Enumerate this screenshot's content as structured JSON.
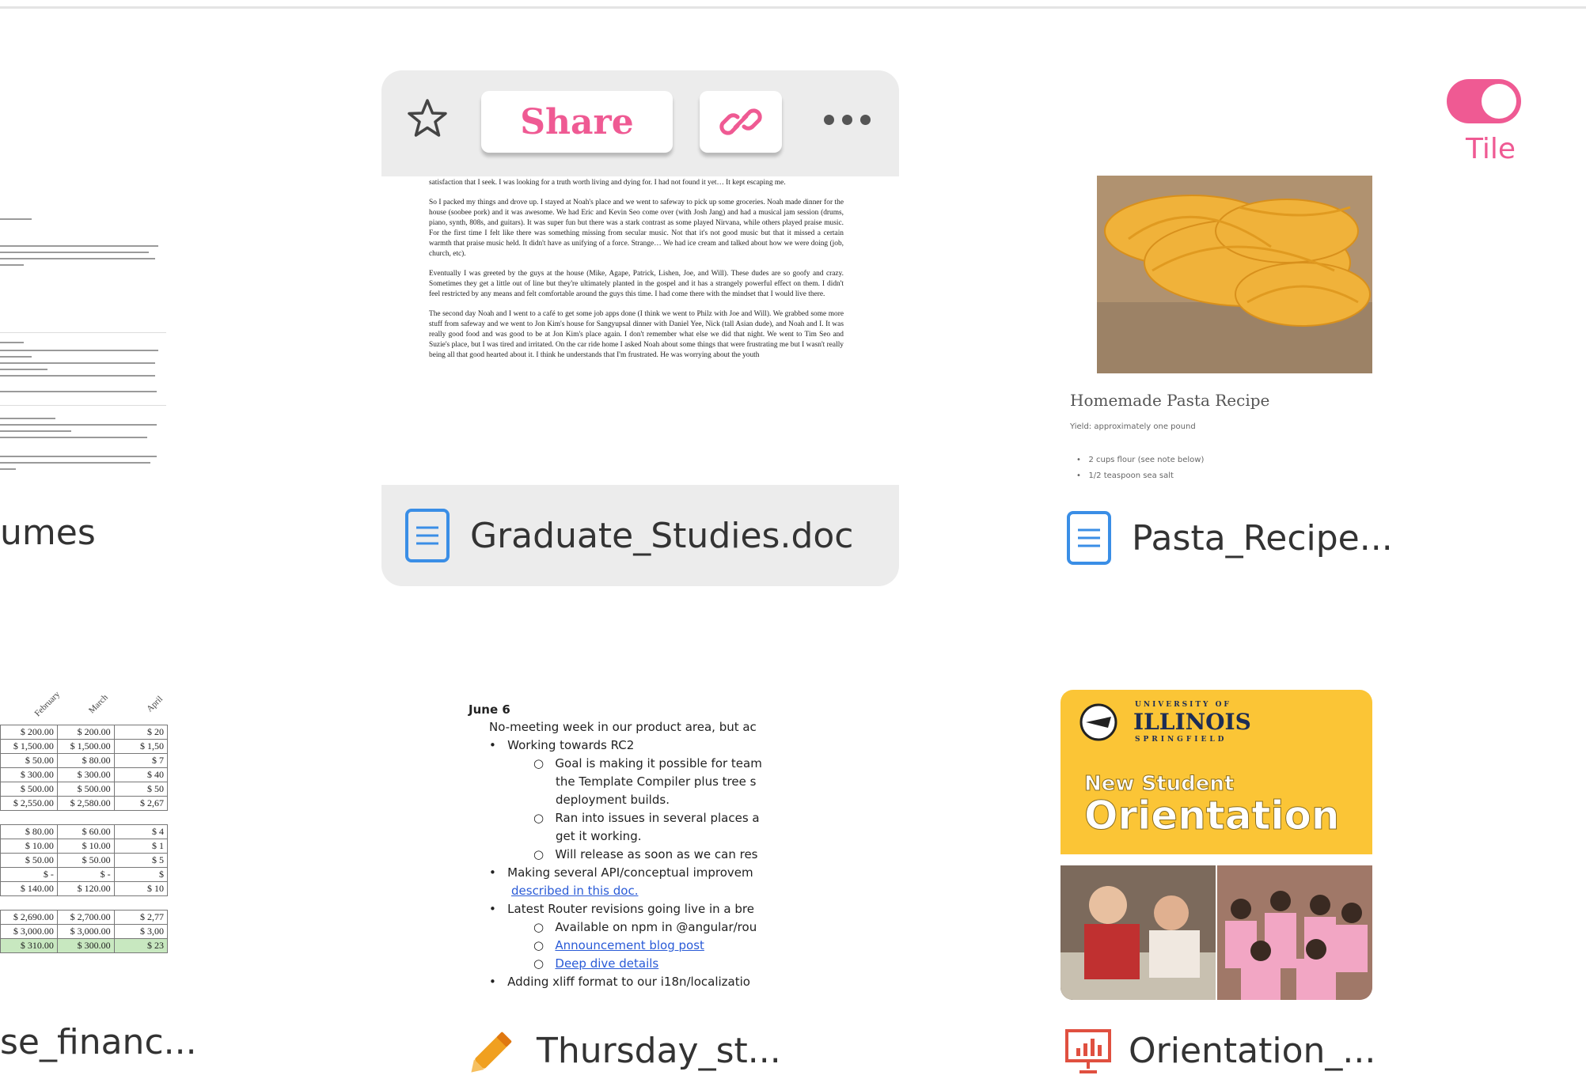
{
  "view_toggle": {
    "label": "Tile",
    "on": true
  },
  "files": {
    "resumes": {
      "name": "umes",
      "icon": "folder-icon"
    },
    "graduate": {
      "name": "Graduate_Studies.doc",
      "icon": "document-icon",
      "actions": {
        "share_label": "Share",
        "link": "link-icon",
        "more": "more-icon",
        "favorite": "star-icon"
      },
      "preview": [
        "satisfaction that I seek. I was looking for a truth worth living and dying for. I had not found it yet… It kept escaping me.",
        "So I packed my things and drove up. I stayed at Noah's place and we went to safeway to pick up some groceries. Noah made dinner for the house (soobee pork) and it was awesome. We had Eric and Kevin Seo come over (with Josh Jang) and had a musical jam session (drums, piano, synth, 808s, and guitars). It was super fun but there was a stark contrast as some played Nirvana, while others played praise music. For the first time I felt like there was something missing from secular music. Not that it's not good music but that it missed a certain warmth that praise music held. It didn't have as unifying of a force. Strange… We had ice cream and talked about how we were doing (job, church, etc).",
        "Eventually I was greeted by the guys at the house (Mike, Agape, Patrick, Lishen, Joe, and Will). These dudes are so goofy and crazy. Sometimes they get a little out of line but they're ultimately planted in the gospel and it has a strangely powerful effect on them. I didn't feel restricted by any means and felt comfortable around the guys this time. I had come there with the mindset that I would live there.",
        "The second day Noah and I went to a café to get some job apps done (I think we went to Philz with Joe and Will). We grabbed some more stuff from safeway and we went to Jon Kim's house for Sangyupsal dinner with Daniel Yee, Nick (tall Asian dude), and Noah and I. It was really good food and was good to be at Jon Kim's place again. I don't remember what else we did that night. We went to Tim Seo and Suzie's place, but I was tired and irritated. On the car ride home I asked Noah about some things that were frustrating me but I wasn't really being all that good hearted about it. I think he understands that I'm frustrated. He was worrying about the youth"
      ]
    },
    "pasta": {
      "name": "Pasta_Recipe...",
      "icon": "document-icon",
      "title": "Homemade Pasta Recipe",
      "yield": "Yield: approximately one pound",
      "items": [
        "2 cups flour (see note below)",
        "1/2 teaspoon sea salt"
      ]
    },
    "finance": {
      "name": "se_financ...",
      "months": [
        "February",
        "March",
        "April"
      ],
      "rows": [
        [
          "$ 200.00",
          "$ 200.00",
          "$ 20"
        ],
        [
          "$ 1,500.00",
          "$ 1,500.00",
          "$ 1,50"
        ],
        [
          "$ 50.00",
          "$ 80.00",
          "$ 7"
        ],
        [
          "$ 300.00",
          "$ 300.00",
          "$ 40"
        ],
        [
          "$ 500.00",
          "$ 500.00",
          "$ 50"
        ],
        [
          "$ 2,550.00",
          "$ 2,580.00",
          "$ 2,67"
        ],
        [
          "$ 80.00",
          "$ 60.00",
          "$ 4"
        ],
        [
          "$ 10.00",
          "$ 10.00",
          "$ 1"
        ],
        [
          "$ 50.00",
          "$ 50.00",
          "$ 5"
        ],
        [
          "$ -",
          "$ -",
          "$"
        ],
        [
          "$ 140.00",
          "$ 120.00",
          "$ 10"
        ],
        [
          "$ 2,690.00",
          "$ 2,700.00",
          "$ 2,77"
        ],
        [
          "$ 3,000.00",
          "$ 3,000.00",
          "$ 3,00"
        ],
        [
          "$ 310.00",
          "$ 300.00",
          "$ 23"
        ]
      ]
    },
    "thursday": {
      "name": "Thursday_st...",
      "icon": "pencil-icon",
      "date": "June 6",
      "lines": [
        "No-meeting week in our product area, but ac",
        "Working towards RC2",
        "Goal is making it possible for team",
        "the Template Compiler plus tree s",
        "deployment builds.",
        "Ran into issues in several places a",
        "get it working.",
        "Will release as soon as we can res",
        "Making several API/conceptual improvem",
        "described in this doc.",
        "Latest Router revisions going live in a bre",
        "Available on npm in @angular/rou",
        "Announcement blog post",
        "Deep dive details",
        "Adding xliff format to our i18n/localizatio"
      ]
    },
    "orientation": {
      "name": "Orientation_...",
      "icon": "presentation-icon",
      "university_top": "UNIVERSITY OF",
      "university": "ILLINOIS",
      "university_bottom": "SPRINGFIELD",
      "subtitle": "New Student",
      "title": "Orientation"
    }
  },
  "colors": {
    "accent": "#ef5a93",
    "doc_blue": "#3a8ee6",
    "pencil": "#f0a020",
    "slides_red": "#e05040",
    "orient_yellow": "#fbc536"
  }
}
